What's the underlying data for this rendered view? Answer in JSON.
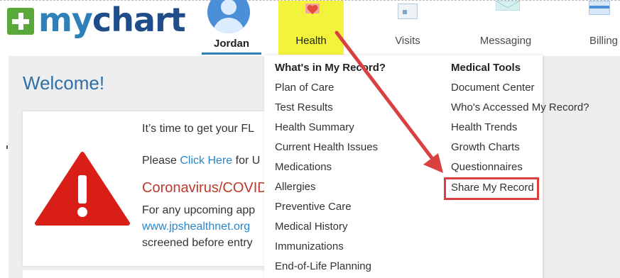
{
  "brand": {
    "logo_my": "my",
    "logo_chart": "chart"
  },
  "user": {
    "name": "Jordan"
  },
  "nav": [
    {
      "label": "Health",
      "icon": "heart-icon",
      "active": true
    },
    {
      "label": "Visits",
      "icon": "calendar-icon"
    },
    {
      "label": "Messaging",
      "icon": "envelope-icon"
    },
    {
      "label": "Billing",
      "icon": "credit-card-icon"
    }
  ],
  "welcome": "Welcome!",
  "alert": {
    "line1": "It’s time to get your FL",
    "line2_prefix": "Please ",
    "line2_link": "Click Here",
    "line2_suffix": " for U",
    "line3": "Coronavirus/COVID",
    "line4": "For any upcoming app",
    "line5": "www.jpshealthnet.org",
    "line6": "screened before entry"
  },
  "menu": {
    "left": {
      "heading": "What's in My Record?",
      "items": [
        "Plan of Care",
        "Test Results",
        "Health Summary",
        "Current Health Issues",
        "Medications",
        "Allergies",
        "Preventive Care",
        "Medical History",
        "Immunizations",
        "End-of-Life Planning"
      ]
    },
    "right": {
      "heading": "Medical Tools",
      "items": [
        "Document Center",
        "Who's Accessed My Record?",
        "Health Trends",
        "Growth Charts",
        "Questionnaires",
        "Share My Record"
      ]
    }
  },
  "colors": {
    "accent": "#2f80b9",
    "highlight_yellow": "#f3f33c",
    "annotation_red": "#d94141",
    "warning_red": "#c0392b"
  }
}
